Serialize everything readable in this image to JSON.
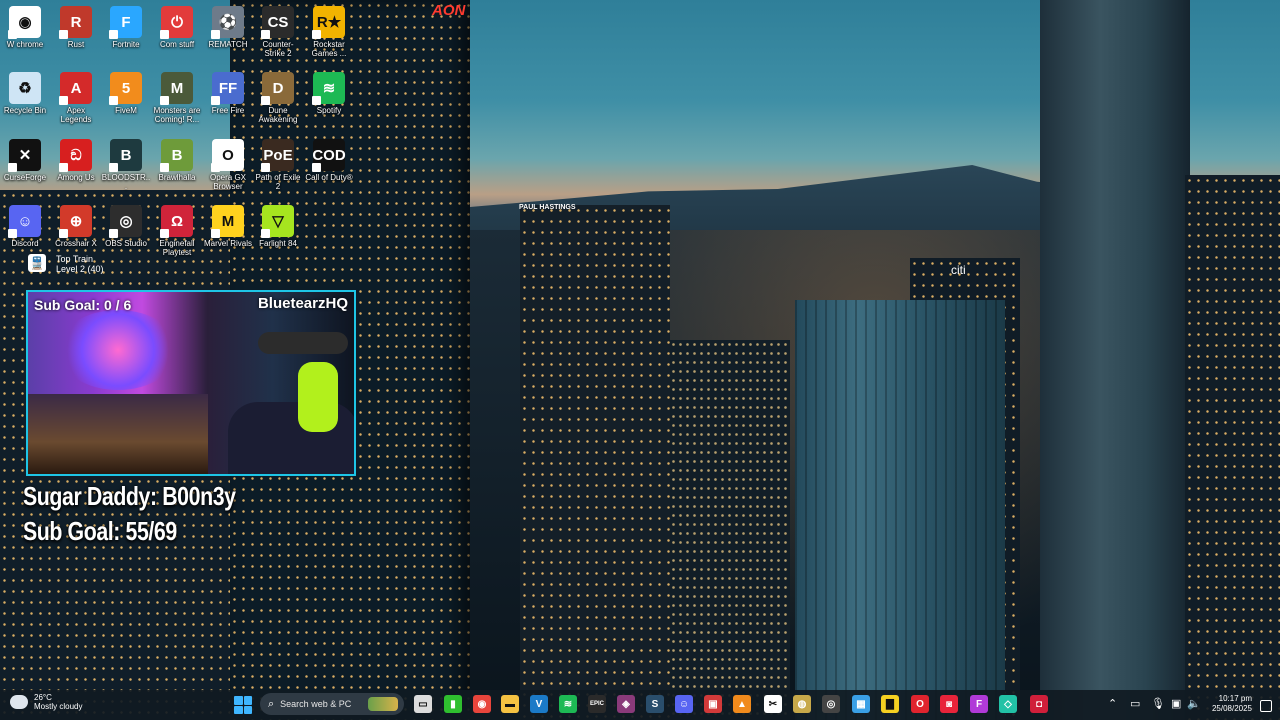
{
  "desktop_icons": [
    {
      "label": "W chrome",
      "color": "#ffffff",
      "glyph": "◉"
    },
    {
      "label": "Rust",
      "color": "#c0392b",
      "glyph": "R"
    },
    {
      "label": "Fortnite",
      "color": "#2aa7ff",
      "glyph": "F"
    },
    {
      "label": "Com stuff",
      "color": "#e23b3b",
      "glyph": "⏻"
    },
    {
      "label": "REMATCH",
      "color": "#6e7b8a",
      "glyph": "⚽"
    },
    {
      "label": "Counter-Strike 2",
      "color": "#2b2b2b",
      "glyph": "CS"
    },
    {
      "label": "Rockstar Games ...",
      "color": "#f2b300",
      "glyph": "R★"
    },
    {
      "label": "Recycle Bin",
      "color": "#cfe5f5",
      "glyph": "♻"
    },
    {
      "label": "Apex Legends",
      "color": "#d42a2a",
      "glyph": "A"
    },
    {
      "label": "FiveM",
      "color": "#f28c1c",
      "glyph": "5"
    },
    {
      "label": "Monsters are Coming! R...",
      "color": "#4b5a3a",
      "glyph": "M"
    },
    {
      "label": "Free Fire",
      "color": "#4a6ccf",
      "glyph": "FF"
    },
    {
      "label": "Dune Awakening",
      "color": "#8a6a3a",
      "glyph": "D"
    },
    {
      "label": "Spotify",
      "color": "#1db954",
      "glyph": "≋"
    },
    {
      "label": "CurseForge",
      "color": "#111111",
      "glyph": "✕"
    },
    {
      "label": "Among Us",
      "color": "#d71f1f",
      "glyph": "ඞ"
    },
    {
      "label": "BLOODSTR...",
      "color": "#1e3a3f",
      "glyph": "B"
    },
    {
      "label": "Brawlhalla",
      "color": "#6e9b3a",
      "glyph": "B"
    },
    {
      "label": "Opera GX Browser",
      "color": "#ffffff",
      "glyph": "O"
    },
    {
      "label": "Path of Exile 2",
      "color": "#3a2a20",
      "glyph": "PoE"
    },
    {
      "label": "Call of Duty®",
      "color": "#111111",
      "glyph": "COD"
    },
    {
      "label": "Discord",
      "color": "#5865f2",
      "glyph": "☺"
    },
    {
      "label": "Crosshair X",
      "color": "#d23a2a",
      "glyph": "⊕"
    },
    {
      "label": "OBS Studio",
      "color": "#2d2d2d",
      "glyph": "◎"
    },
    {
      "label": "Enginefall Playtest",
      "color": "#d0243a",
      "glyph": "Ω"
    },
    {
      "label": "Marvel Rivals",
      "color": "#ffd21e",
      "glyph": "M"
    },
    {
      "label": "Farlight 84",
      "color": "#a6e51f",
      "glyph": "▽"
    }
  ],
  "overlay": {
    "top_train": {
      "title": "Top Train",
      "level": "Level 2  (40)"
    },
    "cam_sub_goal": "Sub Goal:  0 / 6",
    "cam_name": "BluetearzHQ",
    "big_line_1": "Sugar Daddy: B00n3y",
    "big_line_2": "Sub Goal: 55/69"
  },
  "wallpaper": {
    "sign_paul_hastings": "PAUL HASTINGS",
    "sign_citi": "citi",
    "sign_aon": "AON"
  },
  "taskbar": {
    "weather_temp": "26°C",
    "weather_desc": "Mostly cloudy",
    "search_placeholder": "Search web & PC",
    "apps": [
      {
        "name": "file-icon",
        "color": "#dcdcdc",
        "glyph": "▭"
      },
      {
        "name": "xbox-icon",
        "color": "#2fbf2f",
        "glyph": "▮"
      },
      {
        "name": "chrome-icon",
        "color": "#e8453c",
        "glyph": "◉"
      },
      {
        "name": "folder-icon",
        "color": "#f5c242",
        "glyph": "▬"
      },
      {
        "name": "vscode-icon",
        "color": "#1b7ac7",
        "glyph": "V"
      },
      {
        "name": "spotify-icon",
        "color": "#1db954",
        "glyph": "≋"
      },
      {
        "name": "epic-icon",
        "color": "#2a2a2a",
        "glyph": "EPIC"
      },
      {
        "name": "app-icon",
        "color": "#8a3a7a",
        "glyph": "◈"
      },
      {
        "name": "steam-icon",
        "color": "#2a4e6c",
        "glyph": "S"
      },
      {
        "name": "discord-icon",
        "color": "#5865f2",
        "glyph": "☺"
      },
      {
        "name": "app2-icon",
        "color": "#d23a3a",
        "glyph": "▣"
      },
      {
        "name": "vlc-icon",
        "color": "#f08a1c",
        "glyph": "▲"
      },
      {
        "name": "capcut-icon",
        "color": "#ffffff",
        "glyph": "✂"
      },
      {
        "name": "app3-icon",
        "color": "#c8a94a",
        "glyph": "◍"
      },
      {
        "name": "obs-icon",
        "color": "#444444",
        "glyph": "◎"
      },
      {
        "name": "photos-icon",
        "color": "#3aa0e6",
        "glyph": "▦"
      },
      {
        "name": "notes-icon",
        "color": "#f5d021",
        "glyph": "▇"
      },
      {
        "name": "opera-icon",
        "color": "#e0242e",
        "glyph": "O"
      },
      {
        "name": "gx-icon",
        "color": "#e8243a",
        "glyph": "◙"
      },
      {
        "name": "figma-icon",
        "color": "#b03ad8",
        "glyph": "F"
      },
      {
        "name": "app4-icon",
        "color": "#22c2a6",
        "glyph": "◇"
      },
      {
        "name": "app5-icon",
        "color": "#d01f3a",
        "glyph": "◘"
      }
    ],
    "time": "10:17 pm",
    "date": "25/08/2025"
  }
}
